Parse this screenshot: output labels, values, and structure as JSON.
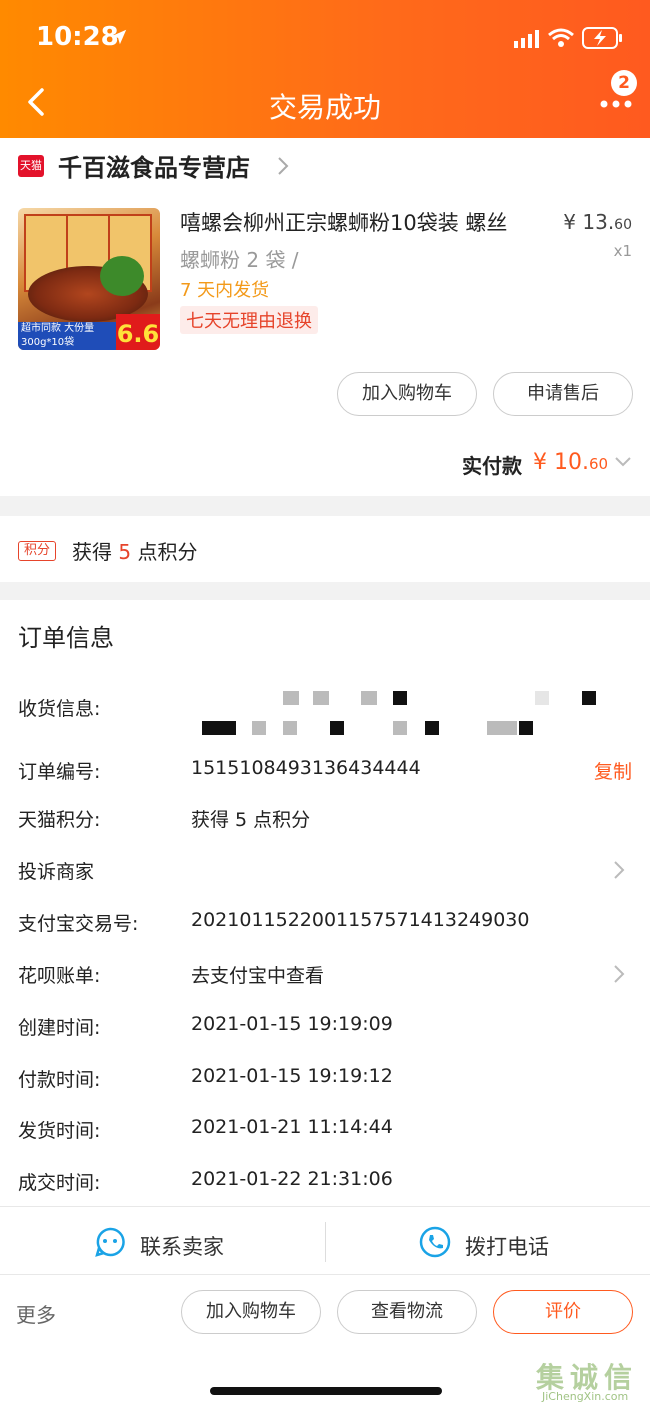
{
  "status_bar": {
    "time": "10:28"
  },
  "header": {
    "title": "交易成功",
    "badge_count": "2"
  },
  "store": {
    "logo_text": "天猫",
    "name": "千百滋食品专营店"
  },
  "product": {
    "title": "嘻螺会柳州正宗螺蛳粉10袋装 螺丝",
    "spec": "螺蛳粉 2 袋 /",
    "ship_note": "7 天内发货",
    "return_tag": "七天无理由退换",
    "price_main": "¥ 13.",
    "price_cents": "60",
    "qty": "x1",
    "thumb_label_a": "超市同款 大份量300g*10袋",
    "thumb_label_b": "6.6"
  },
  "buttons": {
    "add_to_cart": "加入购物车",
    "after_sale": "申请售后",
    "more": "更多",
    "view_logistics": "查看物流",
    "review": "评价"
  },
  "paid": {
    "label": "实付款",
    "amount_main": "¥ 10.",
    "amount_cents": "60"
  },
  "points": {
    "tag": "积分",
    "prefix": "获得 ",
    "num": "5",
    "suffix": " 点积分"
  },
  "order": {
    "title": "订单信息",
    "receiver_label": "收货信息:",
    "order_no_label": "订单编号:",
    "order_no": "1515108493136434444",
    "copy": "复制",
    "tmall_points_label": "天猫积分:",
    "tmall_points": "获得 5 点积分",
    "complain_label": "投诉商家",
    "alipay_label": "支付宝交易号:",
    "alipay_no": "2021011522001157571413249030",
    "huabei_label": "花呗账单:",
    "huabei_value": "去支付宝中查看",
    "created_label": "创建时间:",
    "created": "2021-01-15 19:19:09",
    "paid_label": "付款时间:",
    "paid": "2021-01-15 19:19:12",
    "shipped_label": "发货时间:",
    "shipped": "2021-01-21 11:14:44",
    "closed_label": "成交时间:",
    "closed": "2021-01-22 21:31:06"
  },
  "contact": {
    "seller": "联系卖家",
    "phone": "拨打电话"
  },
  "watermark": {
    "main": "集诚信",
    "sub": "JiChengXin.com"
  },
  "colors": {
    "accent": "#ff5a1f",
    "header_start": "#ff8a00",
    "price_red": "#e6442b"
  }
}
